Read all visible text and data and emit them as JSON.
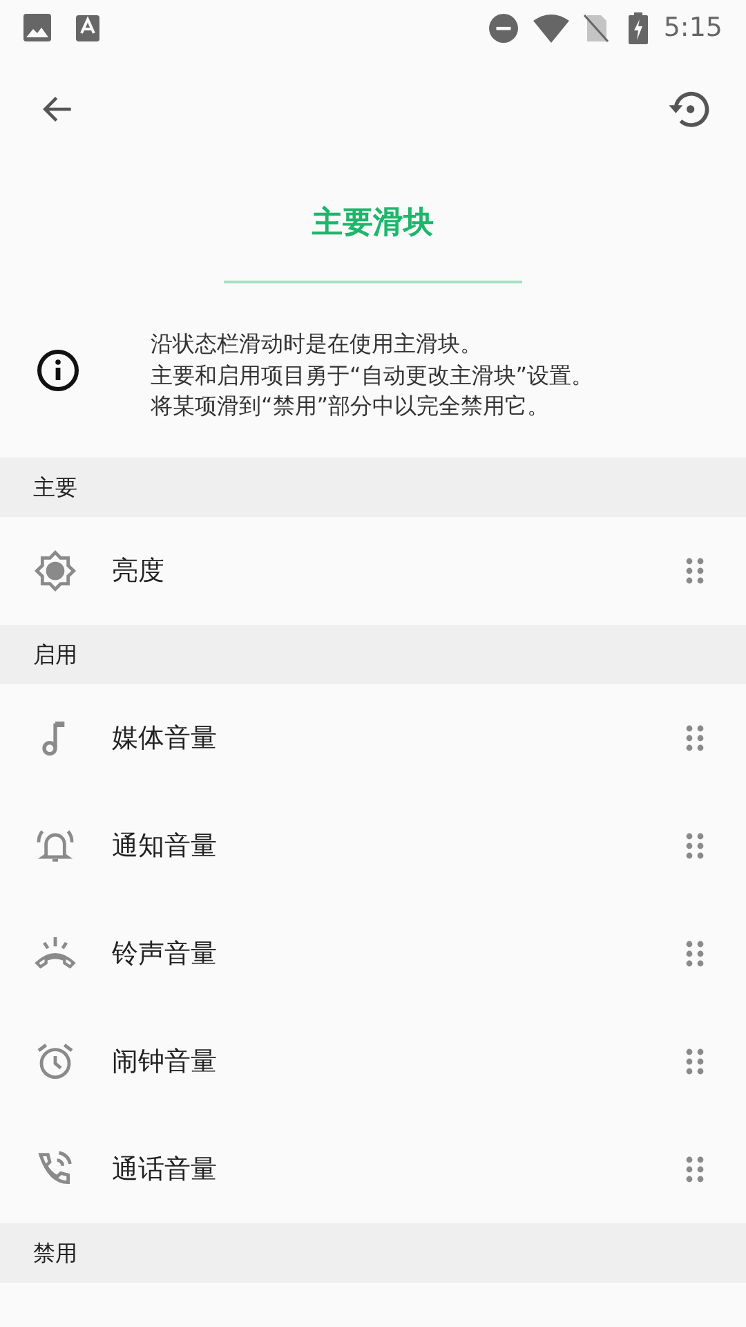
{
  "status_bar": {
    "time": "5:15"
  },
  "title": "主要滑块",
  "info": {
    "lines": [
      "沿状态栏滑动时是在使用主滑块。",
      "主要和启用项目勇于“自动更改主滑块”设置。",
      "将某项滑到“禁用”部分中以完全禁用它。"
    ]
  },
  "sections": [
    {
      "title": "主要",
      "items": [
        {
          "label": "亮度",
          "kind": "brightness"
        }
      ]
    },
    {
      "title": "启用",
      "items": [
        {
          "label": "媒体音量",
          "kind": "media"
        },
        {
          "label": "通知音量",
          "kind": "notification"
        },
        {
          "label": "铃声音量",
          "kind": "ringer"
        },
        {
          "label": "闹钟音量",
          "kind": "alarm"
        },
        {
          "label": "通话音量",
          "kind": "call"
        }
      ]
    },
    {
      "title": "禁用"
    }
  ]
}
